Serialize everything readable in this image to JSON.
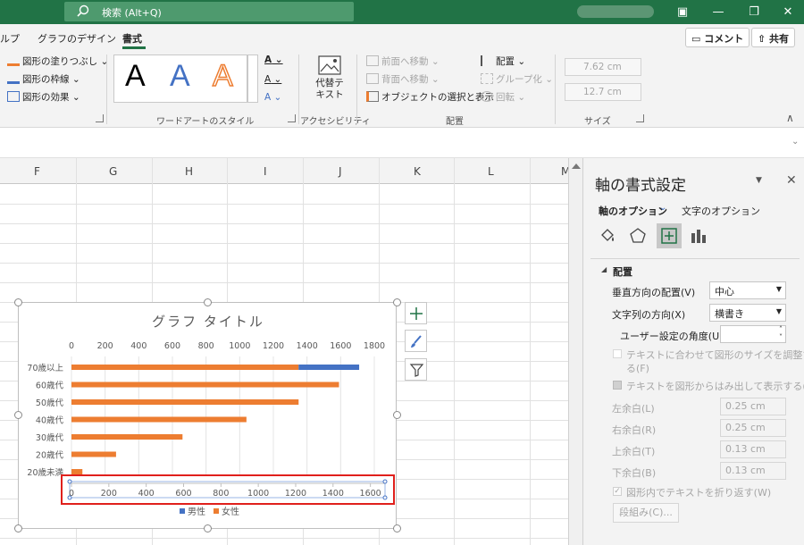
{
  "titlebar": {
    "search_placeholder": "検索 (Alt+Q)",
    "btn_ribbon_display": "▣",
    "btn_minimize": "—",
    "btn_restore": "❐",
    "btn_close": "✕"
  },
  "tabs": {
    "help_partial": "ルプ",
    "chart_design": "グラフのデザイン",
    "format": "書式",
    "comment": "コメント",
    "share": "共有"
  },
  "ribbon": {
    "shape_fill": "図形の塗りつぶし",
    "shape_outline": "図形の枠線",
    "shape_effects": "図形の効果",
    "wordart_letter": "A",
    "wordart_group": "ワードアートのスタイル",
    "alt_text_line1": "代替テ",
    "alt_text_line2": "キスト",
    "accessibility_group": "アクセシビリティ",
    "bring_forward": "前面へ移動",
    "send_backward": "背面へ移動",
    "selection_pane": "オブジェクトの選択と表示",
    "align": "配置",
    "group": "グループ化",
    "rotate": "回転",
    "arrange_group": "配置",
    "height": "7.62 cm",
    "width": "12.7 cm",
    "size_group": "サイズ"
  },
  "sheet": {
    "columns": [
      "F",
      "G",
      "H",
      "I",
      "J",
      "K",
      "L",
      "M"
    ]
  },
  "chart_data": {
    "type": "bar",
    "title": "グラフ タイトル",
    "categories": [
      "70歳以上",
      "60歳代",
      "50歳代",
      "40歳代",
      "30歳代",
      "20歳代",
      "20歳未満"
    ],
    "series": [
      {
        "name": "女性",
        "color": "#ed7d31",
        "values": [
          1350,
          1590,
          1350,
          1040,
          660,
          265,
          65
        ]
      },
      {
        "name": "男性",
        "color": "#4472c4",
        "values": [
          360,
          0,
          0,
          0,
          0,
          0,
          0
        ]
      }
    ],
    "xlim": [
      0,
      1800
    ],
    "top_axis_ticks": [
      "0",
      "200",
      "400",
      "600",
      "800",
      "1000",
      "1200",
      "1400",
      "1600",
      "1800"
    ],
    "bottom_axis_ticks": [
      "0",
      "200",
      "400",
      "600",
      "800",
      "1000",
      "1200",
      "1400",
      "1600"
    ],
    "legend": [
      "男性",
      "女性"
    ],
    "legend_position": "bottom"
  },
  "pane": {
    "title": "軸の書式設定",
    "tab_axis": "軸のオプション",
    "tab_text": "文字のオプション",
    "section": "配置",
    "vertical_align_label": "垂直方向の配置(V)",
    "vertical_align_value": "中心",
    "text_direction_label": "文字列の方向(X)",
    "text_direction_value": "横書き",
    "custom_angle_label": "ユーザー設定の角度(U)",
    "resize_shape_line1": "テキストに合わせて図形のサイズを調整す",
    "resize_shape_line2": "る(F)",
    "overflow_text": "テキストを図形からはみ出して表示する(O)",
    "margin_left_label": "左余白(L)",
    "margin_left": "0.25 cm",
    "margin_right_label": "右余白(R)",
    "margin_right": "0.25 cm",
    "margin_top_label": "上余白(T)",
    "margin_top": "0.13 cm",
    "margin_bottom_label": "下余白(B)",
    "margin_bottom": "0.13 cm",
    "wrap_text": "図形内でテキストを折り返す(W)",
    "columns_button": "段組み(C)..."
  }
}
